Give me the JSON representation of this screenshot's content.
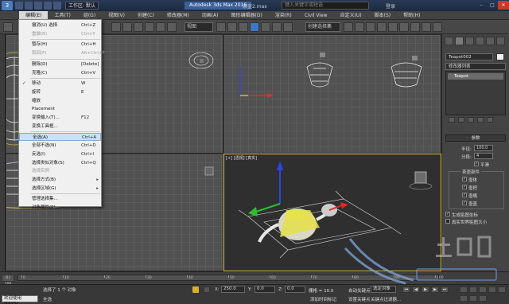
{
  "titlebar": {
    "workspace": "工作区: 默认",
    "app_title": "Autodesk 3ds Max 2016",
    "file_name": "茶壶2.max",
    "search_placeholder": "键入关键字或短语",
    "login": "登录",
    "min": "–",
    "max": "□",
    "close": "✕"
  },
  "menubar": {
    "items": [
      "编辑(E)",
      "工具(T)",
      "组(G)",
      "视图(V)",
      "创建(C)",
      "修改器(M)",
      "动画(A)",
      "图形编辑器(D)",
      "渲染(R)",
      "Civil View",
      "自定义(U)",
      "脚本(S)",
      "帮助(H)"
    ]
  },
  "toolbar": {
    "view_dropdown": "视图",
    "selection_set_dropdown": "创建选择集"
  },
  "edit_menu": {
    "items": [
      {
        "label": "撤消(U) 选择",
        "shortcut": "Ctrl+Z",
        "disabled": false
      },
      {
        "label": "重做(R)",
        "shortcut": "Ctrl+Y",
        "disabled": true
      },
      {
        "label": "暂存(H)",
        "shortcut": "Ctrl+H",
        "disabled": false
      },
      {
        "label": "取回(F)",
        "shortcut": "Alt+Ctrl+F",
        "disabled": true
      },
      {
        "label": "删除(D)",
        "shortcut": "[Delete]",
        "disabled": false
      },
      {
        "label": "克隆(C)",
        "shortcut": "Ctrl+V",
        "disabled": false
      },
      {
        "label": "移动",
        "shortcut": "W",
        "disabled": false,
        "checked": true
      },
      {
        "label": "旋转",
        "shortcut": "E",
        "disabled": false
      },
      {
        "label": "缩放",
        "shortcut": "",
        "disabled": false
      },
      {
        "label": "Placement",
        "shortcut": "",
        "disabled": false
      },
      {
        "label": "变换输入(T)...",
        "shortcut": "F12",
        "disabled": false
      },
      {
        "label": "变换工具框...",
        "shortcut": "",
        "disabled": false
      },
      {
        "label": "全选(A)",
        "shortcut": "Ctrl+A",
        "disabled": false,
        "highlighted": true
      },
      {
        "label": "全部不选(N)",
        "shortcut": "Ctrl+D",
        "disabled": false
      },
      {
        "label": "反选(I)",
        "shortcut": "Ctrl+I",
        "disabled": false
      },
      {
        "label": "选择类似对象(S)",
        "shortcut": "Ctrl+Q",
        "disabled": false
      },
      {
        "label": "选择实例",
        "shortcut": "",
        "disabled": true
      },
      {
        "label": "选择方式(B)",
        "shortcut": "",
        "disabled": false,
        "submenu": true
      },
      {
        "label": "选择区域(G)",
        "shortcut": "",
        "disabled": false,
        "submenu": true
      },
      {
        "label": "管理选择集...",
        "shortcut": "",
        "disabled": false
      },
      {
        "label": "对象属性(P)...",
        "shortcut": "",
        "disabled": false
      }
    ]
  },
  "viewports": {
    "perspective_label": "[+] [透视] [真实]"
  },
  "command_panel": {
    "object_name": "Teapot002",
    "modifier_list": "修改器列表",
    "stack_item": "Teapot",
    "params_header": "参数",
    "radius_label": "半径:",
    "radius_value": "100.0",
    "segments_label": "分段:",
    "segments_value": "4",
    "smooth_label": "平滑",
    "parts_label": "茶壶部件",
    "parts": [
      "壶体",
      "壶把",
      "壶嘴",
      "壶盖"
    ],
    "gen_uv": "生成贴图坐标",
    "real_world": "真实世界贴图大小"
  },
  "timeline": {
    "frame_display": "0 / 100",
    "ticks": [
      "0",
      "10",
      "20",
      "30",
      "40",
      "50",
      "60",
      "70",
      "80",
      "90",
      "100"
    ]
  },
  "statusbar": {
    "maxscript": "欢迎使用 MAXSc",
    "selection_info": "选择了 1 个 对象",
    "prompt": "全选",
    "x_label": "X:",
    "x_value": "250.0",
    "y_label": "Y:",
    "y_value": "0.0",
    "z_label": "Z:",
    "z_value": "0.0",
    "grid": "栅格 = 10.0",
    "add_time_tag": "添加时间标记",
    "autokey": "自动关键点",
    "selected_obj": "选定对象",
    "set_key": "设置关键点",
    "key_filter": "关键点过滤器..."
  },
  "colors": {
    "menu_highlight": "#cfdff3",
    "viewport_active": "#e4c047",
    "close_button": "#c73b2c"
  }
}
